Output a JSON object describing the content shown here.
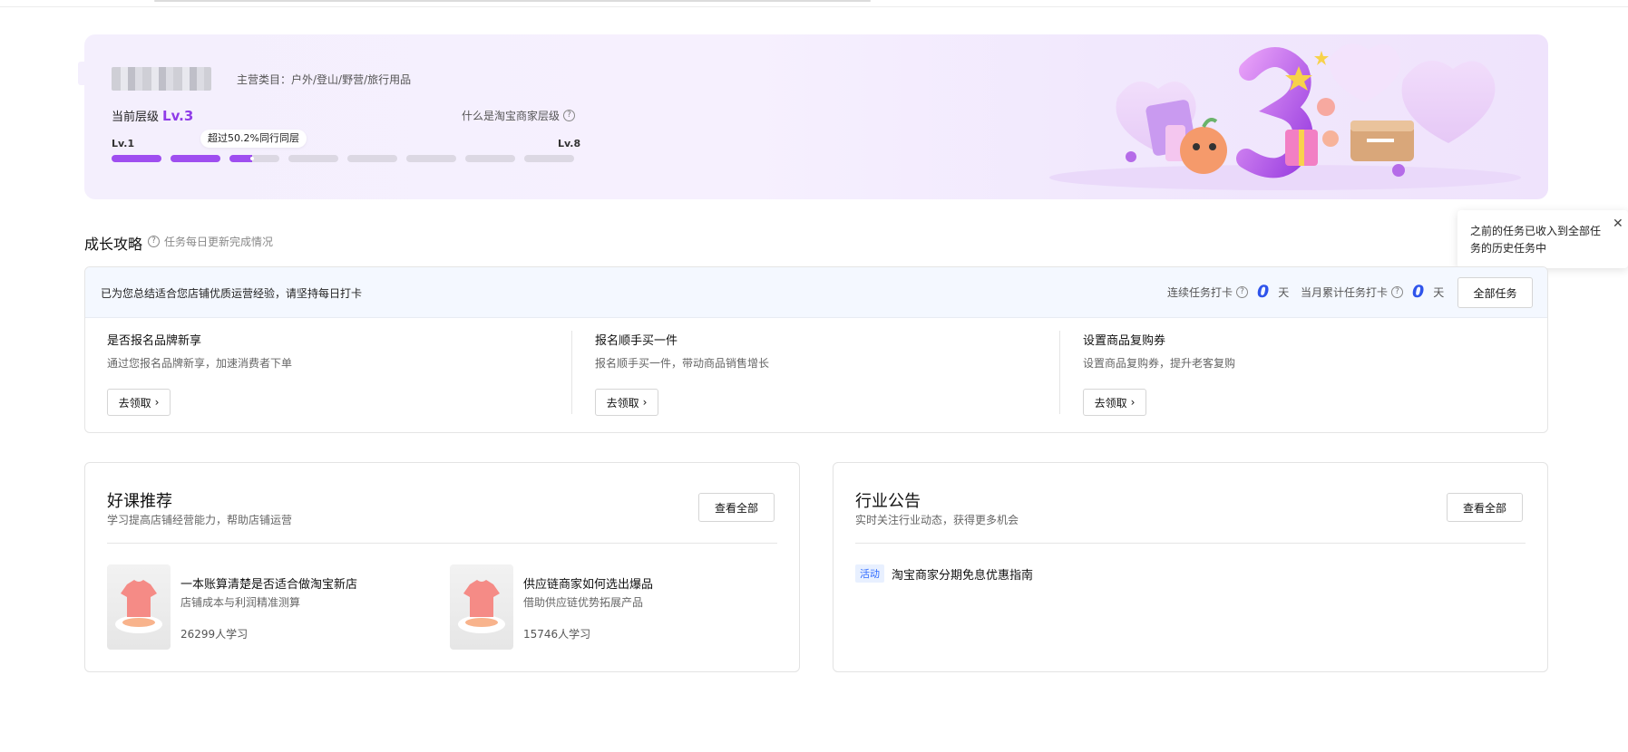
{
  "banner": {
    "category": "主营类目：户外/登山/野营/旅行用品",
    "level_label": "当前层级",
    "level_value": "Lv.3",
    "what_level": "什么是淘宝商家层级",
    "lv_min": "Lv.1",
    "lv_max": "Lv.8",
    "tip": "超过50.2%同行同层",
    "progress": {
      "completed_levels": 2,
      "current_level_fraction": 0.45,
      "total_segments": 8
    }
  },
  "growth": {
    "title": "成长攻略",
    "subtitle": "任务每日更新完成情况",
    "popover_text": "之前的任务已收入到全部任务的历史任务中",
    "head_text": "已为您总结适合您店铺优质运营经验，请坚持每日打卡",
    "streak_label": "连续任务打卡",
    "streak_value": "0",
    "streak_unit": "天",
    "month_label": "当月累计任务打卡",
    "month_value": "0",
    "month_unit": "天",
    "all_tasks": "全部任务",
    "tasks": [
      {
        "title": "是否报名品牌新享",
        "desc": "通过您报名品牌新享，加速消费者下单",
        "button": "去领取"
      },
      {
        "title": "报名顺手买一件",
        "desc": "报名顺手买一件，带动商品销售增长",
        "button": "去领取"
      },
      {
        "title": "设置商品复购券",
        "desc": "设置商品复购券，提升老客复购",
        "button": "去领取"
      }
    ]
  },
  "courses": {
    "title": "好课推荐",
    "subtitle": "学习提高店铺经营能力，帮助店铺运营",
    "view_all": "查看全部",
    "items": [
      {
        "title": "一本账算清楚是否适合做淘宝新店",
        "desc": "店铺成本与利润精准测算",
        "count": "26299人学习"
      },
      {
        "title": "供应链商家如何选出爆品",
        "desc": "借助供应链优势拓展产品",
        "count": "15746人学习"
      }
    ]
  },
  "notices": {
    "title": "行业公告",
    "subtitle": "实时关注行业动态，获得更多机会",
    "view_all": "查看全部",
    "items": [
      {
        "tag": "活动",
        "text": "淘宝商家分期免息优惠指南"
      }
    ]
  },
  "colors": {
    "accent_purple": "#9f4ef0",
    "accent_blue": "#2f54eb"
  }
}
